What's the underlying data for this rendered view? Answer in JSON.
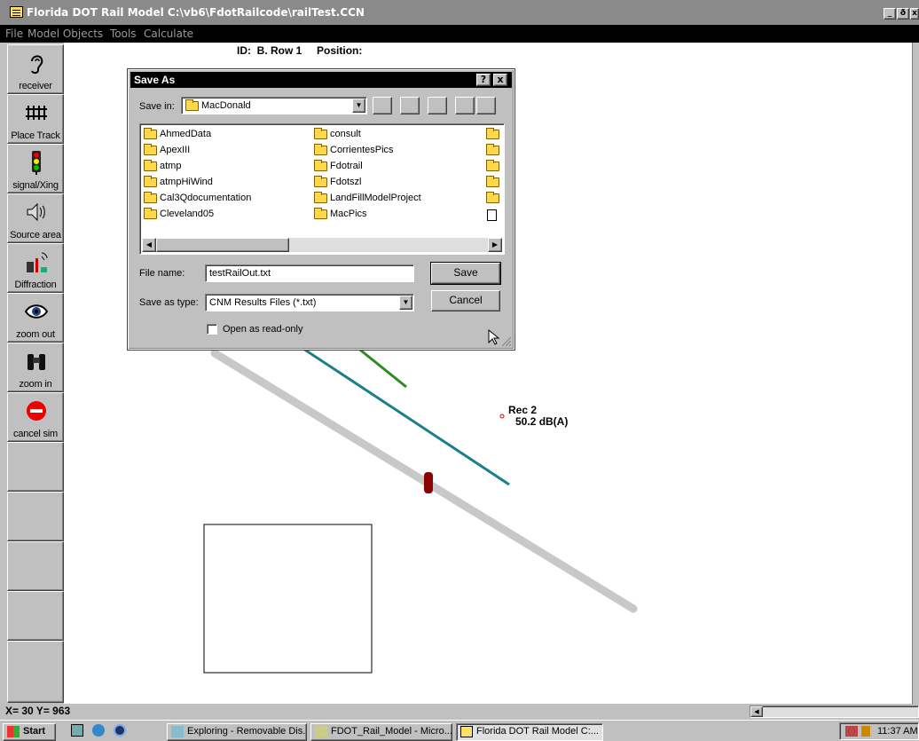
{
  "window": {
    "title": "Florida DOT Rail Model  C:\\vb6\\FdotRailcode\\railTest.CCN",
    "controls": [
      "_",
      "ð",
      "x"
    ]
  },
  "menu": [
    {
      "label": "File"
    },
    {
      "label": "Model Objects"
    },
    {
      "label": "Tools"
    },
    {
      "label": "Calculate"
    }
  ],
  "toolbar": [
    {
      "label": "receiver",
      "icon": "ear-icon"
    },
    {
      "label": "Place Track",
      "icon": "track-icon"
    },
    {
      "label": "signal/Xing",
      "icon": "traffic-light-icon"
    },
    {
      "label": "Source area",
      "icon": "speaker-icon"
    },
    {
      "label": "Diffraction",
      "icon": "diffraction-icon"
    },
    {
      "label": "zoom out",
      "icon": "eye-icon"
    },
    {
      "label": "zoom in",
      "icon": "binoculars-icon"
    },
    {
      "label": "cancel sim",
      "icon": "stop-icon"
    }
  ],
  "canvas": {
    "id_label": "ID:",
    "id_value": "B. Row 1",
    "position_label": "Position:",
    "receiver_name": "Rec 2",
    "receiver_level": "50.2 dB(A)"
  },
  "dialog": {
    "title": "Save As",
    "help_btn": "?",
    "close_btn": "x",
    "save_in_label": "Save in:",
    "save_in_value": "MacDonald",
    "files_col1": [
      "AhmedData",
      "ApexIII",
      "atmp",
      "atmpHiWind",
      "Cal3Qdocumentation",
      "Cleveland05"
    ],
    "files_col2": [
      "consult",
      "CorrientesPics",
      "Fdotrail",
      "Fdotszl",
      "LandFillModelProject",
      "MacPics"
    ],
    "file_name_label": "File name:",
    "file_name_value": "testRailOut.txt",
    "save_type_label": "Save as type:",
    "save_type_value": "CNM Results Files (*.txt)",
    "save_button": "Save",
    "cancel_button": "Cancel",
    "readonly_label": "Open as read-only"
  },
  "status": {
    "coords": "X= 30 Y= 963"
  },
  "taskbar": {
    "start": "Start",
    "tasks": [
      {
        "label": "Exploring - Removable Dis..."
      },
      {
        "label": "FDOT_Rail_Model - Micro..."
      },
      {
        "label": "Florida DOT Rail Model C:..."
      }
    ],
    "clock": "11:37 AM"
  },
  "colors": {
    "track": "#c8c8c8",
    "teal_line": "#1a7f8c",
    "green_line": "#2e8b22",
    "train": "#8b0000",
    "dialog_title": "#000000"
  }
}
